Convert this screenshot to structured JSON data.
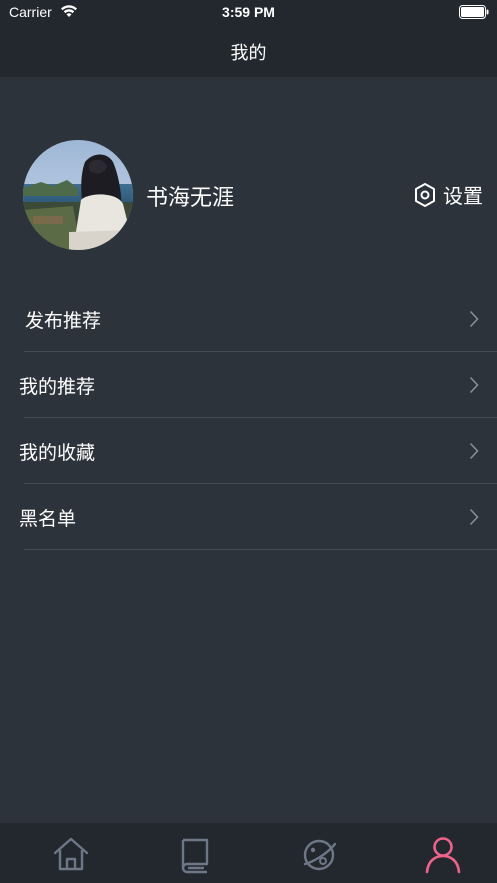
{
  "status_bar": {
    "carrier": "Carrier",
    "time": "3:59 PM"
  },
  "nav": {
    "title": "我的"
  },
  "profile": {
    "username": "书海无涯",
    "settings_label": "设置",
    "settings_icon": "hexagon-settings-icon"
  },
  "menu": {
    "items": [
      {
        "label": "发布推荐"
      },
      {
        "label": "我的推荐"
      },
      {
        "label": "我的收藏"
      },
      {
        "label": "黑名单"
      }
    ]
  },
  "tab_bar": {
    "tabs": [
      {
        "icon": "home-icon",
        "active": false
      },
      {
        "icon": "book-icon",
        "active": false
      },
      {
        "icon": "planet-icon",
        "active": false
      },
      {
        "icon": "user-icon",
        "active": true
      }
    ],
    "active_color": "#f0628a",
    "inactive_color": "#6e7787"
  },
  "colors": {
    "background": "#2d333b",
    "bar_background": "#23282e",
    "divider": "#454c55"
  }
}
